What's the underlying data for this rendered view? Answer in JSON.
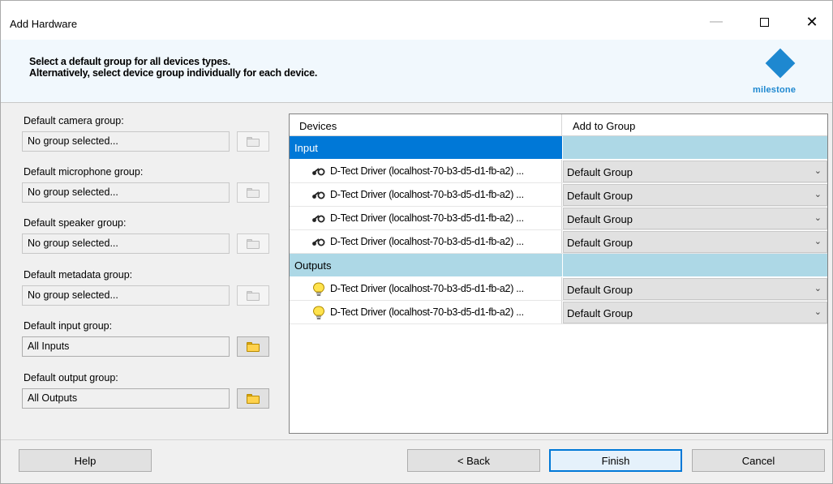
{
  "window": {
    "title": "Add Hardware"
  },
  "header": {
    "line1": "Select a default group for all devices types.",
    "line2": "Alternatively, select device group individually for each device.",
    "logo_text": "milestone",
    "logo_color": "#1e88d0"
  },
  "defaults": [
    {
      "label": "Default camera group:",
      "value": "No group selected...",
      "browse_enabled": false
    },
    {
      "label": "Default microphone group:",
      "value": "No group selected...",
      "browse_enabled": false
    },
    {
      "label": "Default speaker group:",
      "value": "No group selected...",
      "browse_enabled": false
    },
    {
      "label": "Default metadata group:",
      "value": "No group selected...",
      "browse_enabled": false
    },
    {
      "label": "Default input group:",
      "value": "All Inputs",
      "browse_enabled": true
    },
    {
      "label": "Default output group:",
      "value": "All Outputs",
      "browse_enabled": true
    }
  ],
  "grid": {
    "col_devices": "Devices",
    "col_group": "Add to Group",
    "sections": [
      {
        "name": "Input",
        "selected": true,
        "icon": "input-device-icon",
        "rows": [
          {
            "device": "D-Tect Driver (localhost-70-b3-d5-d1-fb-a2) ...",
            "group": "Default Group"
          },
          {
            "device": "D-Tect Driver (localhost-70-b3-d5-d1-fb-a2) ...",
            "group": "Default Group"
          },
          {
            "device": "D-Tect Driver (localhost-70-b3-d5-d1-fb-a2) ...",
            "group": "Default Group"
          },
          {
            "device": "D-Tect Driver (localhost-70-b3-d5-d1-fb-a2) ...",
            "group": "Default Group"
          }
        ]
      },
      {
        "name": "Outputs",
        "selected": false,
        "icon": "lightbulb-icon",
        "rows": [
          {
            "device": "D-Tect Driver (localhost-70-b3-d5-d1-fb-a2) ...",
            "group": "Default Group"
          },
          {
            "device": "D-Tect Driver (localhost-70-b3-d5-d1-fb-a2) ...",
            "group": "Default Group"
          }
        ]
      }
    ]
  },
  "buttons": {
    "help": "Help",
    "back": "< Back",
    "finish": "Finish",
    "cancel": "Cancel"
  },
  "colors": {
    "selection": "#0078d7",
    "section_bg": "#add8e6",
    "header_bg": "#f1f8fd"
  }
}
